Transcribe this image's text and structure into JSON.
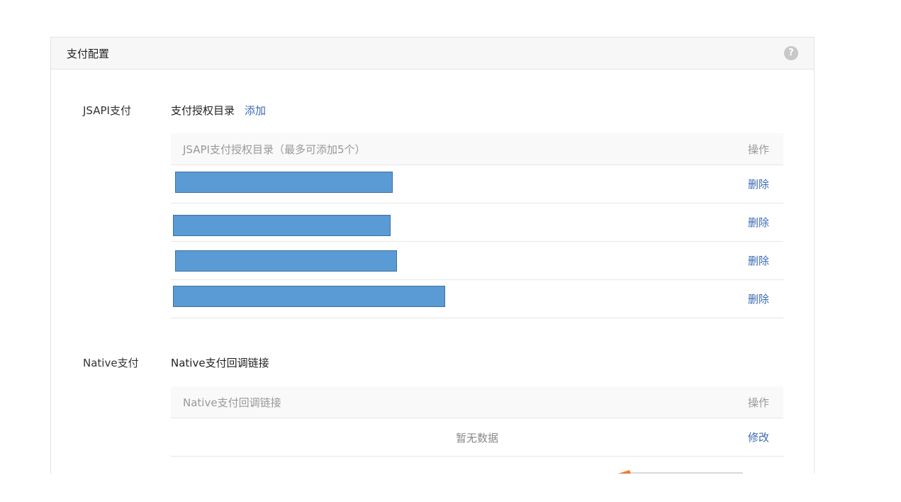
{
  "panel": {
    "title": "支付配置",
    "help_icon": "question-icon",
    "help_glyph": "?"
  },
  "jsapi": {
    "label": "JSAPI支付",
    "title": "支付授权目录",
    "add_label": "添加",
    "table": {
      "header_left": "JSAPI支付授权目录（最多可添加5个）",
      "header_right": "操作",
      "rows": [
        {
          "action": "删除"
        },
        {
          "action": "删除"
        },
        {
          "action": "删除"
        },
        {
          "action": "删除"
        }
      ]
    }
  },
  "native": {
    "label": "Native支付",
    "title": "Native支付回调链接",
    "table": {
      "header_left": "Native支付回调链接",
      "header_right": "操作",
      "empty_text": "暂无数据",
      "action": "修改"
    }
  },
  "colors": {
    "link": "#3a6bb3",
    "redaction": "#5b9bd5",
    "header_bg": "#f7f7f7"
  }
}
